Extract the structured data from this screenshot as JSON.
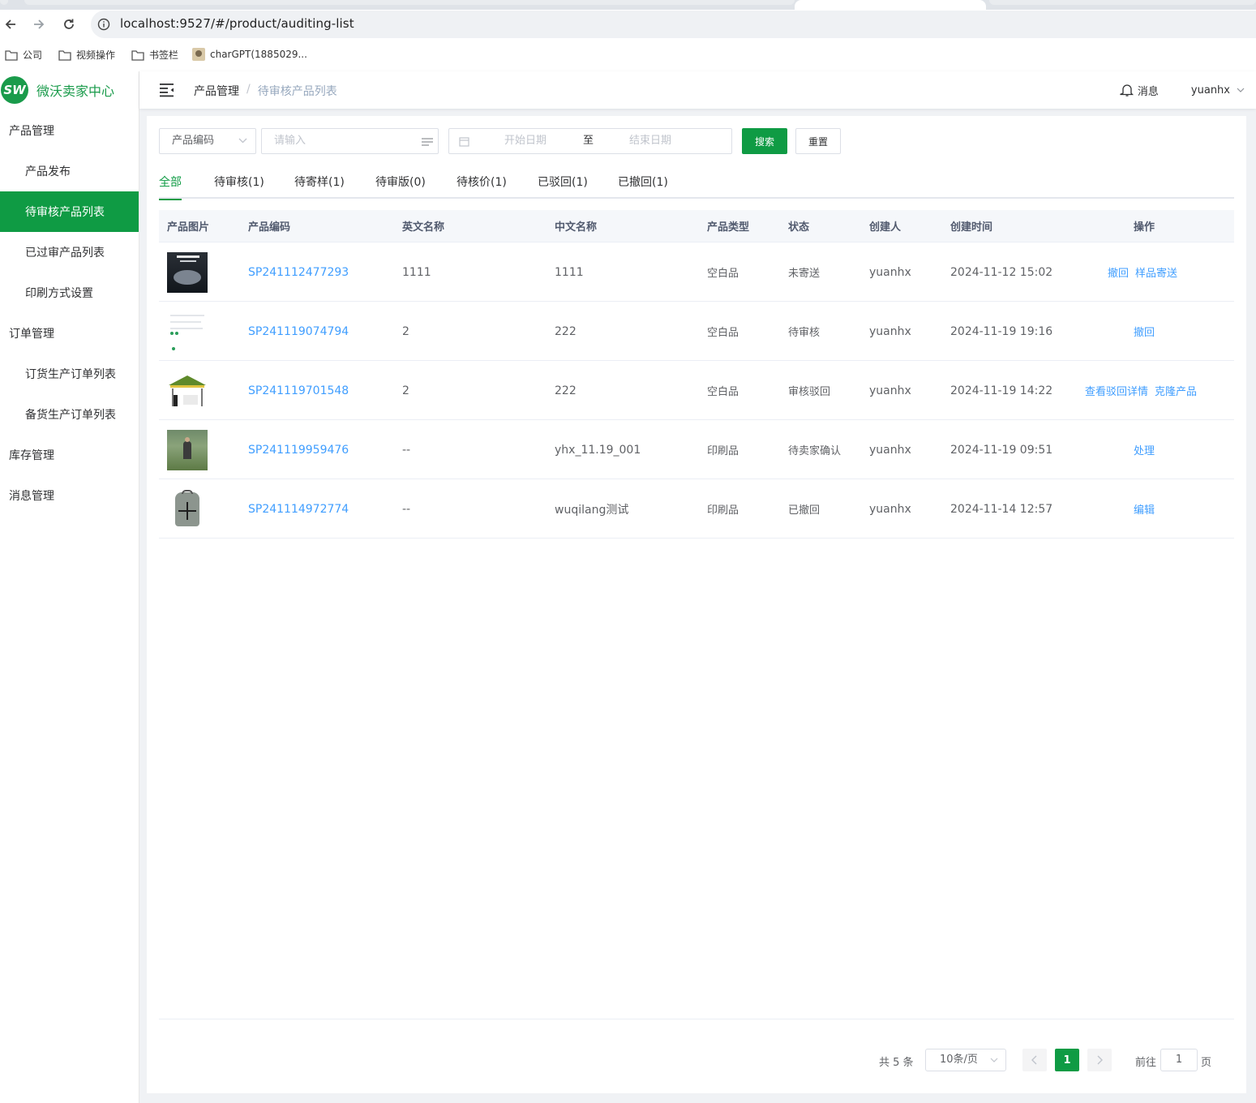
{
  "browser": {
    "url": "localhost:9527/#/product/auditing-list",
    "bookmarks": [
      {
        "label": "公司",
        "icon": "folder-icon"
      },
      {
        "label": "视频操作",
        "icon": "folder-icon"
      },
      {
        "label": "书签栏",
        "icon": "folder-icon"
      },
      {
        "label": "charGPT(1885029...",
        "icon": "avatar-icon"
      }
    ]
  },
  "app": {
    "logo_mark": "SW",
    "logo_text": "微沃卖家中心",
    "accent_color": "#0f9b44"
  },
  "sidebar": {
    "items": [
      {
        "label": "产品管理",
        "level": 1
      },
      {
        "label": "产品发布",
        "level": 2
      },
      {
        "label": "待审核产品列表",
        "level": 2,
        "active": true
      },
      {
        "label": "已过审产品列表",
        "level": 2
      },
      {
        "label": "印刷方式设置",
        "level": 2
      },
      {
        "label": "订单管理",
        "level": 1
      },
      {
        "label": "订货生产订单列表",
        "level": 2
      },
      {
        "label": "备货生产订单列表",
        "level": 2
      },
      {
        "label": "库存管理",
        "level": 1
      },
      {
        "label": "消息管理",
        "level": 1
      }
    ]
  },
  "navbar": {
    "breadcrumb": [
      "产品管理",
      "待审核产品列表"
    ],
    "breadcrumb_sep": "/",
    "messages_label": "消息",
    "username": "yuanhx"
  },
  "filter": {
    "field_select": "产品编码",
    "keyword_placeholder": "请输入",
    "start_date_placeholder": "开始日期",
    "range_separator": "至",
    "end_date_placeholder": "结束日期",
    "search_label": "搜索",
    "reset_label": "重置"
  },
  "tabs": [
    {
      "label": "全部",
      "active": true
    },
    {
      "label": "待审核(1)"
    },
    {
      "label": "待寄样(1)"
    },
    {
      "label": "待审版(0)"
    },
    {
      "label": "待核价(1)"
    },
    {
      "label": "已驳回(1)"
    },
    {
      "label": "已撤回(1)"
    }
  ],
  "table": {
    "columns": [
      "产品图片",
      "产品编码",
      "英文名称",
      "中文名称",
      "产品类型",
      "状态",
      "创建人",
      "创建时间",
      "操作"
    ],
    "rows": [
      {
        "code": "SP241112477293",
        "en_name": "1111",
        "cn_name": "1111",
        "type": "空白品",
        "status": "未寄送",
        "creator": "yuanhx",
        "created": "2024-11-12 15:02",
        "actions": [
          "撤回",
          "样品寄送"
        ],
        "thumb": "pot"
      },
      {
        "code": "SP241119074794",
        "en_name": "2",
        "cn_name": "222",
        "type": "空白品",
        "status": "待审核",
        "creator": "yuanhx",
        "created": "2024-11-19 19:16",
        "actions": [
          "撤回"
        ],
        "thumb": "doc"
      },
      {
        "code": "SP241119701548",
        "en_name": "2",
        "cn_name": "222",
        "type": "空白品",
        "status": "审核驳回",
        "creator": "yuanhx",
        "created": "2024-11-19 14:22",
        "actions": [
          "查看驳回详情",
          "克隆产品"
        ],
        "thumb": "tent"
      },
      {
        "code": "SP241119959476",
        "en_name": "--",
        "cn_name": "yhx_11.19_001",
        "type": "印刷品",
        "status": "待卖家确认",
        "creator": "yuanhx",
        "created": "2024-11-19 09:51",
        "actions": [
          "处理"
        ],
        "thumb": "field"
      },
      {
        "code": "SP241114972774",
        "en_name": "--",
        "cn_name": "wuqilang测试",
        "type": "印刷品",
        "status": "已撤回",
        "creator": "yuanhx",
        "created": "2024-11-14 12:57",
        "actions": [
          "编辑"
        ],
        "thumb": "bag"
      }
    ]
  },
  "pagination": {
    "total_label": "共 5 条",
    "page_size": "10条/页",
    "current_page": "1",
    "goto_label": "前往",
    "goto_value": "1",
    "page_suffix": "页"
  }
}
